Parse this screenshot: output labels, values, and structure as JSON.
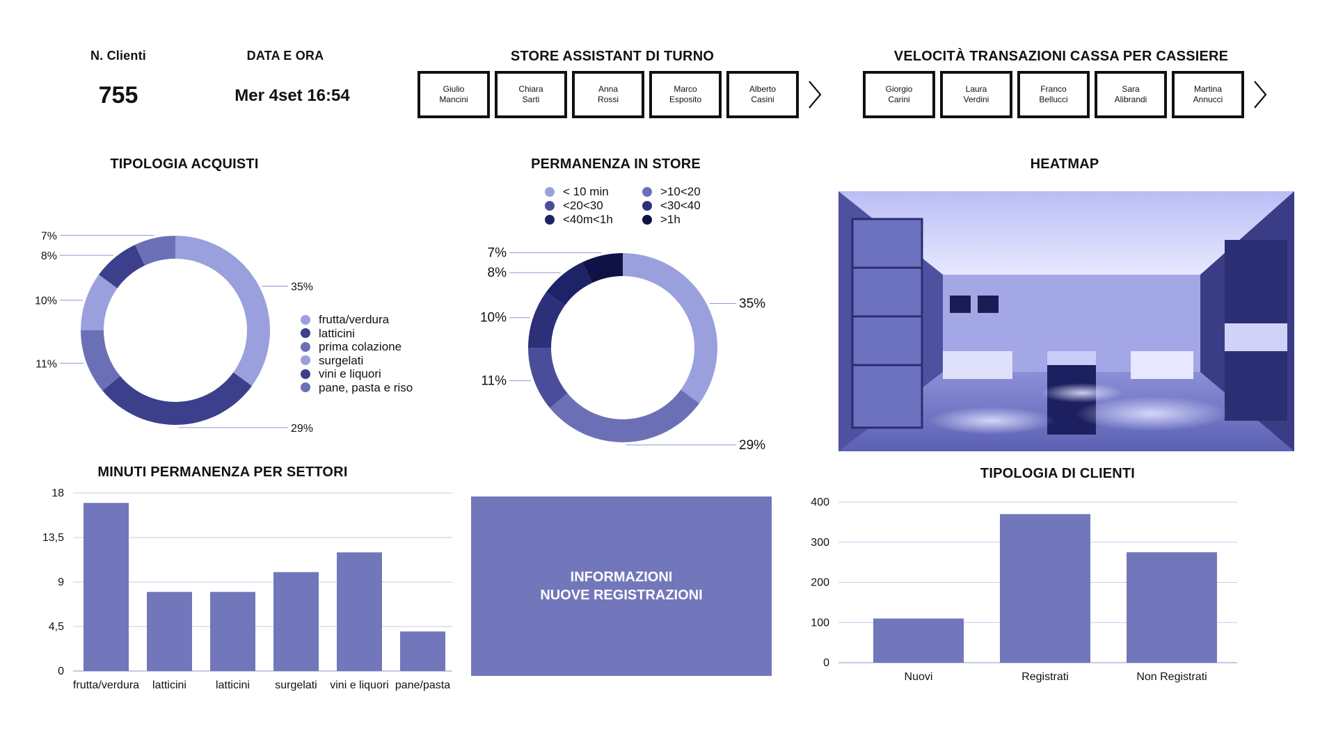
{
  "colors": {
    "light": "#9aa0dd",
    "mid": "#6b70b6",
    "dark": "#3b3f8c",
    "darker": "#262a6c",
    "navy": "#0f1245",
    "grid": "#c8c9ee"
  },
  "header": {
    "clients_label": "N. Clienti",
    "clients_value": "755",
    "datetime_label": "DATA E ORA",
    "datetime_value": "Mer 4set 16:54",
    "assistants_title": "STORE ASSISTANT DI TURNO",
    "assistants": [
      {
        "first": "Giulio",
        "last": "Mancini"
      },
      {
        "first": "Chiara",
        "last": "Sarti"
      },
      {
        "first": "Anna",
        "last": "Rossi"
      },
      {
        "first": "Marco",
        "last": "Esposito"
      },
      {
        "first": "Alberto",
        "last": "Casini"
      }
    ],
    "cashiers_title": "VELOCITÀ TRANSAZIONI CASSA PER CASSIERE",
    "cashiers": [
      {
        "first": "Giorgio",
        "last": "Carini"
      },
      {
        "first": "Laura",
        "last": "Verdini"
      },
      {
        "first": "Franco",
        "last": "Bellucci"
      },
      {
        "first": "Sara",
        "last": "Alibrandi"
      },
      {
        "first": "Martina",
        "last": "Annucci"
      }
    ],
    "next_icon": "chevron-right-icon"
  },
  "heatmap": {
    "title": "HEATMAP"
  },
  "info_box": {
    "line1": "INFORMAZIONI",
    "line2": "NUOVE REGISTRAZIONI"
  },
  "chart_data": [
    {
      "type": "pie",
      "title": "TIPOLOGIA ACQUISTI",
      "categories": [
        "frutta/verdura",
        "latticini",
        "prima colazione",
        "surgelati",
        "vini e liquori",
        "pane, pasta e riso"
      ],
      "legend_colors": [
        "#9aa0dd",
        "#3b3f8c",
        "#6b70b6",
        "#9aa0dd",
        "#3b3f8c",
        "#6b70b6"
      ],
      "slices": [
        {
          "value": 35,
          "label": "35%",
          "color": "#9aa0dd"
        },
        {
          "value": 29,
          "label": "29%",
          "color": "#3b3f8c"
        },
        {
          "value": 11,
          "label": "11%",
          "color": "#6b70b6"
        },
        {
          "value": 10,
          "label": "10%",
          "color": "#9aa0dd"
        },
        {
          "value": 8,
          "label": "8%",
          "color": "#3b3f8c"
        },
        {
          "value": 7,
          "label": "7%",
          "color": "#6b70b6"
        }
      ],
      "legend_position": "right"
    },
    {
      "type": "pie",
      "title": "PERMANENZA IN STORE",
      "legend": [
        {
          "label": "< 10 min",
          "color": "#9aa0dd"
        },
        {
          "label": ">10<20",
          "color": "#6b70b6"
        },
        {
          "label": "<20<30",
          "color": "#4a4e9a"
        },
        {
          "label": "<30<40",
          "color": "#2c3078"
        },
        {
          "label": "<40m<1h",
          "color": "#1e2266"
        },
        {
          "label": ">1h",
          "color": "#0f1245"
        }
      ],
      "slices": [
        {
          "value": 35,
          "label": "35%",
          "color": "#9aa0dd"
        },
        {
          "value": 29,
          "label": "29%",
          "color": "#6b70b6"
        },
        {
          "value": 11,
          "label": "11%",
          "color": "#4a4e9a"
        },
        {
          "value": 10,
          "label": "10%",
          "color": "#2c3078"
        },
        {
          "value": 8,
          "label": "8%",
          "color": "#1e2266"
        },
        {
          "value": 7,
          "label": "7%",
          "color": "#0f1245"
        }
      ],
      "legend_position": "top"
    },
    {
      "type": "bar",
      "title": "MINUTI PERMANENZA PER SETTORI",
      "categories": [
        "frutta/verdura",
        "latticini",
        "latticini",
        "surgelati",
        "vini e liquori",
        "pane/pasta"
      ],
      "values": [
        17,
        8,
        8,
        10,
        12,
        4
      ],
      "yticks": [
        "0",
        "4,5",
        "9",
        "13,5",
        "18"
      ],
      "ylim": [
        0,
        18
      ],
      "grid": true
    },
    {
      "type": "bar",
      "title": "TIPOLOGIA DI CLIENTI",
      "categories": [
        "Nuovi",
        "Registrati",
        "Non Registrati"
      ],
      "values": [
        110,
        370,
        275
      ],
      "yticks": [
        "0",
        "100",
        "200",
        "300",
        "400"
      ],
      "ylim": [
        0,
        400
      ],
      "grid": true
    }
  ]
}
